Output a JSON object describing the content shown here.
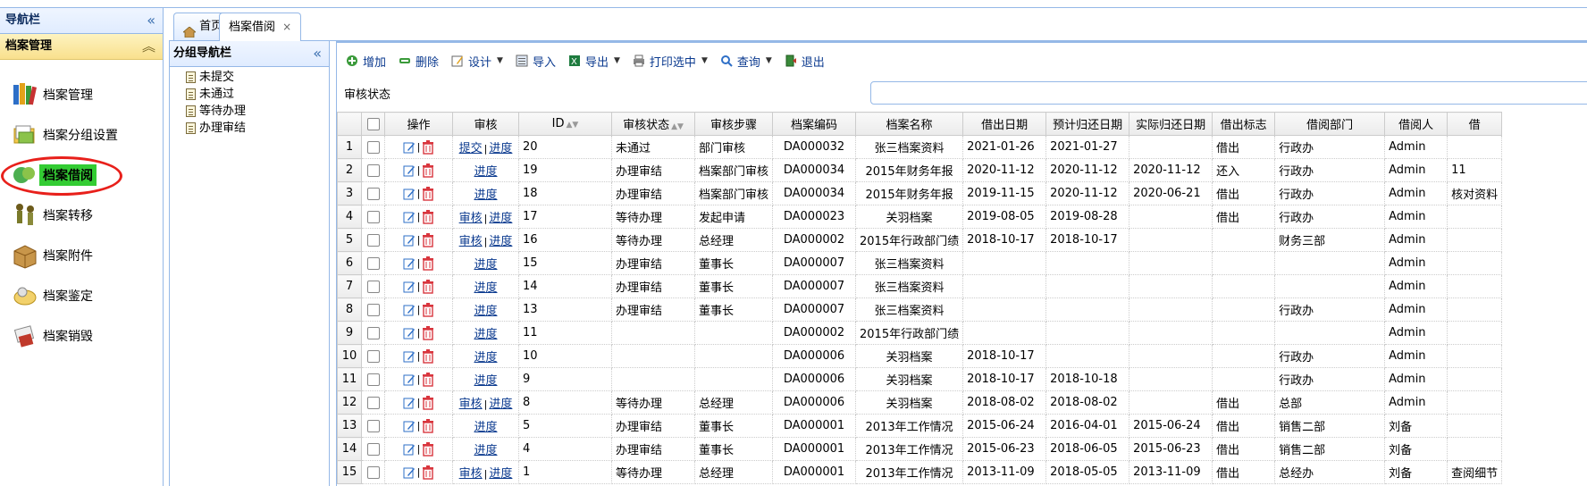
{
  "nav": {
    "title": "导航栏",
    "group": "档案管理",
    "items": [
      {
        "label": "档案管理"
      },
      {
        "label": "档案分组设置"
      },
      {
        "label": "档案借阅"
      },
      {
        "label": "档案转移"
      },
      {
        "label": "档案附件"
      },
      {
        "label": "档案鉴定"
      },
      {
        "label": "档案销毁"
      }
    ]
  },
  "tabs": [
    {
      "label": "首页"
    },
    {
      "label": "档案借阅",
      "close": "×"
    }
  ],
  "groupnav": {
    "title": "分组导航栏",
    "nodes": [
      {
        "label": "未提交"
      },
      {
        "label": "未通过"
      },
      {
        "label": "等待办理"
      },
      {
        "label": "办理审结"
      }
    ]
  },
  "toolbar": {
    "add": "增加",
    "delete": "删除",
    "design": "设计",
    "import": "导入",
    "export": "导出",
    "print": "打印选中",
    "query": "查询",
    "exit": "退出"
  },
  "filter": {
    "label": "审核状态"
  },
  "columns": [
    "操作",
    "审核",
    "ID",
    "审核状态",
    "审核步骤",
    "档案编码",
    "档案名称",
    "借出日期",
    "预计归还日期",
    "实际归还日期",
    "借出标志",
    "借阅部门",
    "借阅人",
    "借"
  ],
  "rows": [
    {
      "n": "1",
      "audit": "提交",
      "prog": "进度",
      "id": "20",
      "status": "未通过",
      "step": "部门审核",
      "code": "DA000032",
      "name": "张三档案资料",
      "out": "2021-01-26",
      "due": "2021-01-27",
      "ret": "",
      "flag": "借出",
      "dept": "行政办",
      "user": "Admin",
      "extra": ""
    },
    {
      "n": "2",
      "audit": "",
      "prog": "进度",
      "id": "19",
      "status": "办理审结",
      "step": "档案部门审核",
      "code": "DA000034",
      "name": "2015年财务年报",
      "out": "2020-11-12",
      "due": "2020-11-12",
      "ret": "2020-11-12",
      "flag": "还入",
      "dept": "行政办",
      "user": "Admin",
      "extra": "11"
    },
    {
      "n": "3",
      "audit": "",
      "prog": "进度",
      "id": "18",
      "status": "办理审结",
      "step": "档案部门审核",
      "code": "DA000034",
      "name": "2015年财务年报",
      "out": "2019-11-15",
      "due": "2020-11-12",
      "ret": "2020-06-21",
      "flag": "借出",
      "dept": "行政办",
      "user": "Admin",
      "extra": "核对资料"
    },
    {
      "n": "4",
      "audit": "审核",
      "prog": "进度",
      "id": "17",
      "status": "等待办理",
      "step": "发起申请",
      "code": "DA000023",
      "name": "关羽档案",
      "out": "2019-08-05",
      "due": "2019-08-28",
      "ret": "",
      "flag": "借出",
      "dept": "行政办",
      "user": "Admin",
      "extra": ""
    },
    {
      "n": "5",
      "audit": "审核",
      "prog": "进度",
      "id": "16",
      "status": "等待办理",
      "step": "总经理",
      "code": "DA000002",
      "name": "2015年行政部门绩",
      "out": "2018-10-17",
      "due": "2018-10-17",
      "ret": "",
      "flag": "",
      "dept": "财务三部",
      "user": "Admin",
      "extra": ""
    },
    {
      "n": "6",
      "audit": "",
      "prog": "进度",
      "id": "15",
      "status": "办理审结",
      "step": "董事长",
      "code": "DA000007",
      "name": "张三档案资料",
      "out": "",
      "due": "",
      "ret": "",
      "flag": "",
      "dept": "",
      "user": "Admin",
      "extra": ""
    },
    {
      "n": "7",
      "audit": "",
      "prog": "进度",
      "id": "14",
      "status": "办理审结",
      "step": "董事长",
      "code": "DA000007",
      "name": "张三档案资料",
      "out": "",
      "due": "",
      "ret": "",
      "flag": "",
      "dept": "",
      "user": "Admin",
      "extra": ""
    },
    {
      "n": "8",
      "audit": "",
      "prog": "进度",
      "id": "13",
      "status": "办理审结",
      "step": "董事长",
      "code": "DA000007",
      "name": "张三档案资料",
      "out": "",
      "due": "",
      "ret": "",
      "flag": "",
      "dept": "行政办",
      "user": "Admin",
      "extra": ""
    },
    {
      "n": "9",
      "audit": "",
      "prog": "进度",
      "id": "11",
      "status": "",
      "step": "",
      "code": "DA000002",
      "name": "2015年行政部门绩",
      "out": "",
      "due": "",
      "ret": "",
      "flag": "",
      "dept": "",
      "user": "Admin",
      "extra": ""
    },
    {
      "n": "10",
      "audit": "",
      "prog": "进度",
      "id": "10",
      "status": "",
      "step": "",
      "code": "DA000006",
      "name": "关羽档案",
      "out": "2018-10-17",
      "due": "",
      "ret": "",
      "flag": "",
      "dept": "行政办",
      "user": "Admin",
      "extra": ""
    },
    {
      "n": "11",
      "audit": "",
      "prog": "进度",
      "id": "9",
      "status": "",
      "step": "",
      "code": "DA000006",
      "name": "关羽档案",
      "out": "2018-10-17",
      "due": "2018-10-18",
      "ret": "",
      "flag": "",
      "dept": "行政办",
      "user": "Admin",
      "extra": ""
    },
    {
      "n": "12",
      "audit": "审核",
      "prog": "进度",
      "id": "8",
      "status": "等待办理",
      "step": "总经理",
      "code": "DA000006",
      "name": "关羽档案",
      "out": "2018-08-02",
      "due": "2018-08-02",
      "ret": "",
      "flag": "借出",
      "dept": "总部",
      "user": "Admin",
      "extra": ""
    },
    {
      "n": "13",
      "audit": "",
      "prog": "进度",
      "id": "5",
      "status": "办理审结",
      "step": "董事长",
      "code": "DA000001",
      "name": "2013年工作情况",
      "out": "2015-06-24",
      "due": "2016-04-01",
      "ret": "2015-06-24",
      "flag": "借出",
      "dept": "销售二部",
      "user": "刘备",
      "extra": ""
    },
    {
      "n": "14",
      "audit": "",
      "prog": "进度",
      "id": "4",
      "status": "办理审结",
      "step": "董事长",
      "code": "DA000001",
      "name": "2013年工作情况",
      "out": "2015-06-23",
      "due": "2018-06-05",
      "ret": "2015-06-23",
      "flag": "借出",
      "dept": "销售二部",
      "user": "刘备",
      "extra": ""
    },
    {
      "n": "15",
      "audit": "审核",
      "prog": "进度",
      "id": "1",
      "status": "等待办理",
      "step": "总经理",
      "code": "DA000001",
      "name": "2013年工作情况",
      "out": "2013-11-09",
      "due": "2018-05-05",
      "ret": "2013-11-09",
      "flag": "借出",
      "dept": "总经办",
      "user": "刘备",
      "extra": "查阅细节"
    }
  ]
}
